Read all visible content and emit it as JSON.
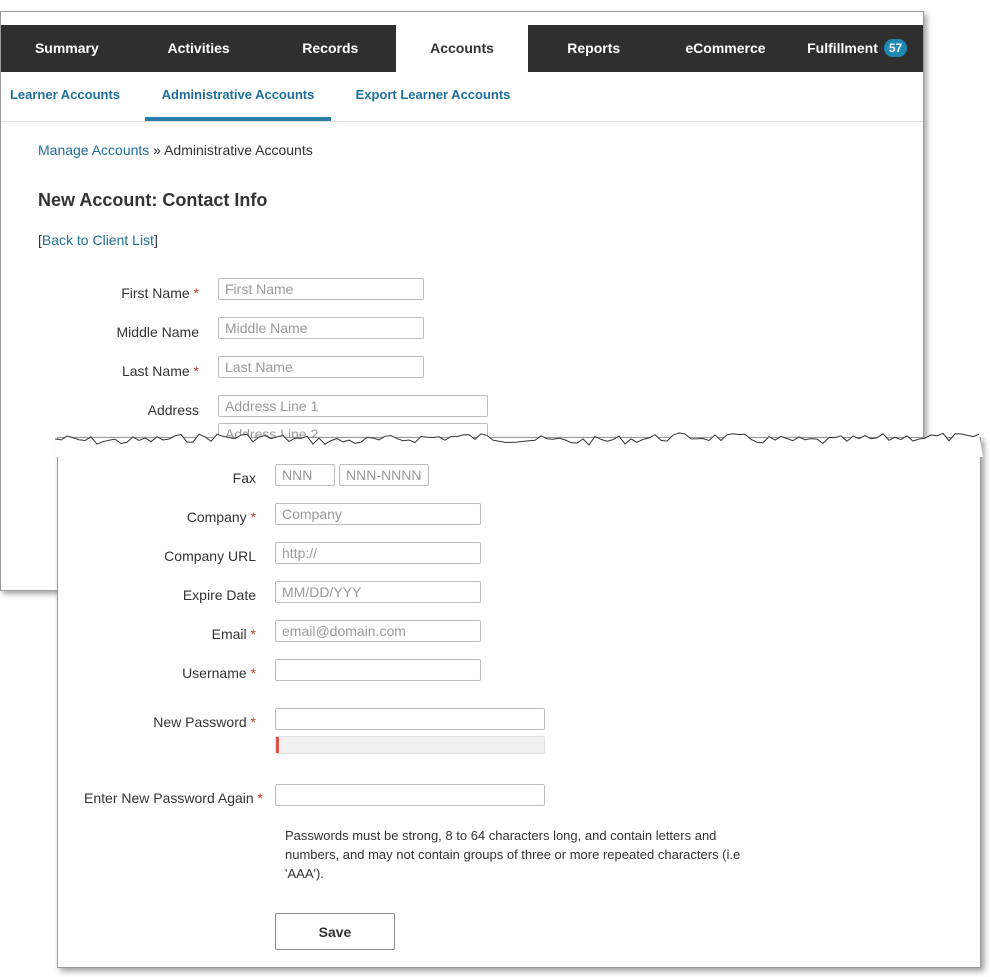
{
  "top_nav": {
    "tabs": [
      {
        "label": "Summary"
      },
      {
        "label": "Activities"
      },
      {
        "label": "Records"
      },
      {
        "label": "Accounts",
        "active": true
      },
      {
        "label": "Reports"
      },
      {
        "label": "eCommerce"
      },
      {
        "label": "Fulfillment",
        "badge": "57"
      }
    ]
  },
  "sub_nav": {
    "items": [
      {
        "label": "Learner Accounts"
      },
      {
        "label": "Administrative Accounts",
        "active": true
      },
      {
        "label": "Export Learner Accounts"
      }
    ]
  },
  "breadcrumb": {
    "link": "Manage Accounts",
    "separator": " » ",
    "current": "Administrative Accounts"
  },
  "page_title": "New Account: Contact Info",
  "back_link": {
    "open": "[",
    "label": "Back to Client List",
    "close": "]"
  },
  "required_marker": "*",
  "form": {
    "first_name": {
      "label": "First Name",
      "placeholder": "First Name"
    },
    "middle_name": {
      "label": "Middle Name",
      "placeholder": "Middle Name"
    },
    "last_name": {
      "label": "Last Name",
      "placeholder": "Last Name"
    },
    "address": {
      "label": "Address",
      "placeholder_1": "Address Line 1",
      "placeholder_2": "Address Line 2"
    },
    "fax": {
      "label": "Fax",
      "placeholder_area": "NNN",
      "placeholder_number": "NNN-NNNN"
    },
    "company": {
      "label": "Company",
      "placeholder": "Company"
    },
    "company_url": {
      "label": "Company URL",
      "placeholder": "http://"
    },
    "expire_date": {
      "label": "Expire Date",
      "placeholder": "MM/DD/YYY"
    },
    "email": {
      "label": "Email",
      "placeholder": "email@domain.com"
    },
    "username": {
      "label": "Username",
      "value": ""
    },
    "new_password": {
      "label": "New Password",
      "value": "",
      "strength": 0.01
    },
    "confirm_password": {
      "label": "Enter New Password Again",
      "value": ""
    },
    "password_note": "Passwords must be strong, 8 to 64 characters long, and contain letters and numbers, and may not contain groups of three or more repeated characters (i.e 'AAA').",
    "save_label": "Save"
  },
  "colors": {
    "nav_bg": "#2f2f2f",
    "link": "#1f6f9a",
    "accent": "#2a7ea6",
    "badge": "#1e8ab4",
    "required": "#c0392b",
    "strength_weak": "#d9534f"
  }
}
